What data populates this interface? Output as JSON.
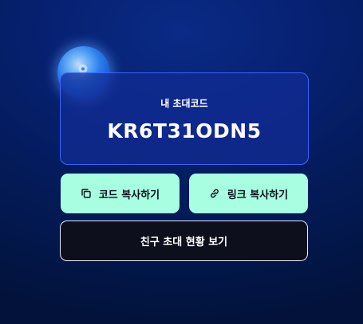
{
  "invite_card": {
    "label": "내 초대코드",
    "code": "KR6T31ODN5"
  },
  "actions": {
    "copy_code_label": "코드 복사하기",
    "copy_link_label": "링크 복사하기",
    "view_status_label": "친구 초대 현황 보기"
  },
  "icons": {
    "copy": "copy-icon",
    "link": "link-icon",
    "orb": "location-orb-icon"
  },
  "colors": {
    "background": "#031a55",
    "card_border": "#3d63ff",
    "mint_button": "#a8fee0",
    "dark_button": "#0e0f1c"
  }
}
